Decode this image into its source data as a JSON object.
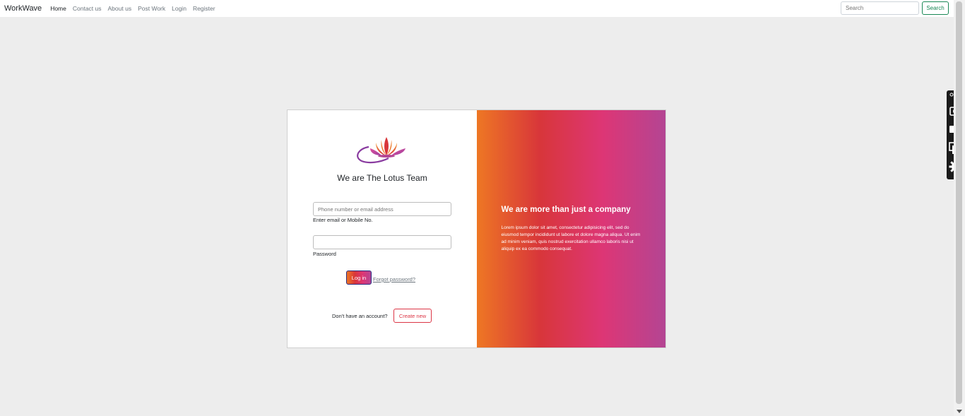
{
  "navbar": {
    "brand": "WorkWave",
    "links": [
      "Home",
      "Contact us",
      "About us",
      "Post Work",
      "Login",
      "Register"
    ],
    "search_placeholder": "Search",
    "search_button": "Search"
  },
  "login": {
    "title": "We are The Lotus Team",
    "email_placeholder": "Phone number or email address",
    "email_label": "Enter email or Mobile No.",
    "password_label": "Password",
    "login_button": "Log in",
    "forgot_link": "Forgot password?",
    "no_account_text": "Don't have an account?",
    "create_button": "Create new"
  },
  "promo": {
    "title": "We are more than just a company",
    "text": "Lorem ipsum dolor sit amet, consectetur adipisicing elit, sed do eiusmod tempor incididunt ut labore et dolore magna aliqua. Ut enim ad minim veniam, quis nostrud exercitation ullamco laboris nisi ut aliquip ex ea commodo consequat."
  },
  "side_toolbar": {
    "icons": [
      "camera-icon",
      "video-icon",
      "windows-icon",
      "gear-icon"
    ]
  },
  "colors": {
    "gradient": [
      "#ee7724",
      "#d8363a",
      "#dd3675",
      "#b44593"
    ],
    "search_green": "#198754",
    "create_red": "#dc3545"
  }
}
